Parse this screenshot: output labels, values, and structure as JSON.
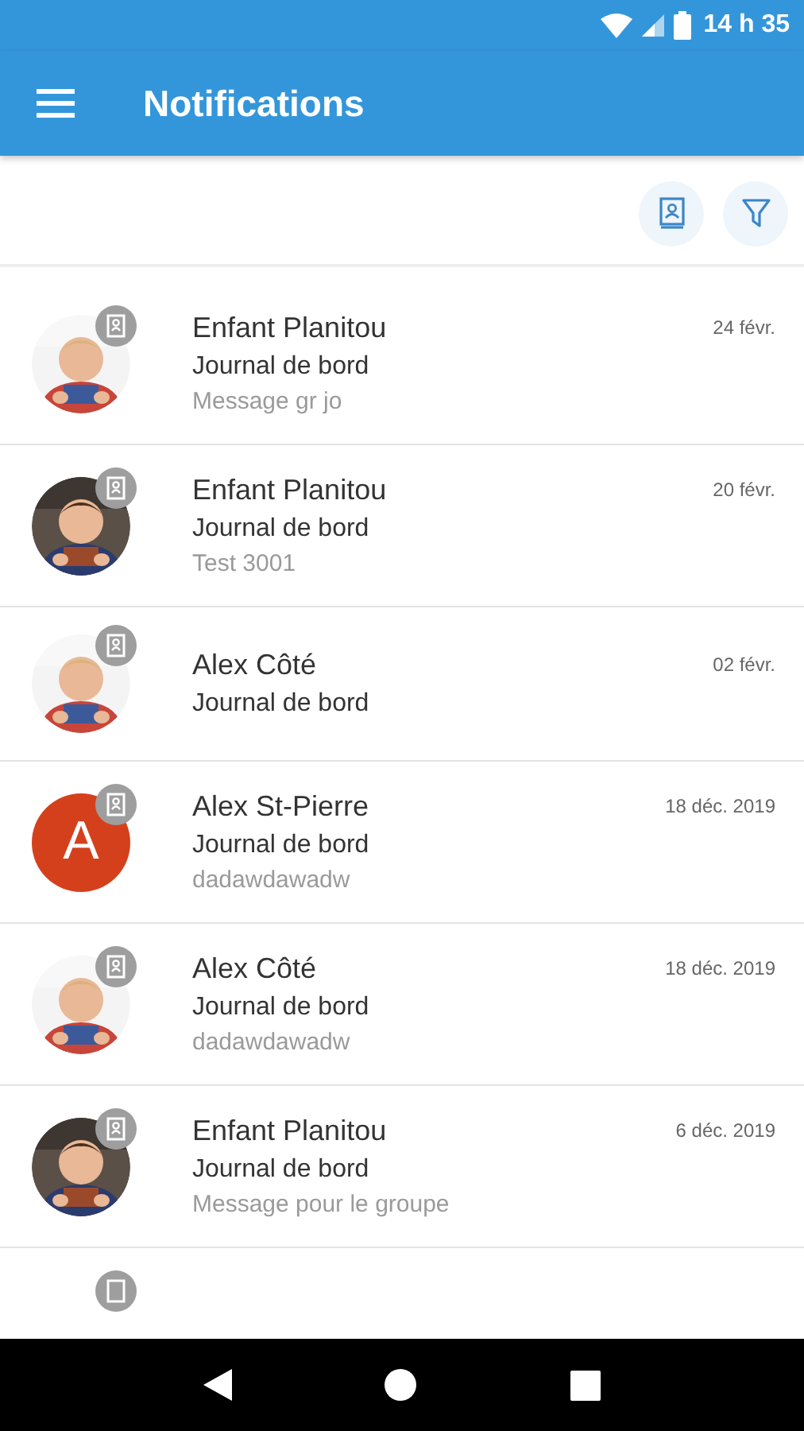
{
  "status_bar": {
    "time": "14 h 35"
  },
  "app_bar": {
    "title": "Notifications"
  },
  "notifications": [
    {
      "name": "Enfant Planitou",
      "category": "Journal de bord",
      "message": "Message gr jo",
      "date": "24 févr."
    },
    {
      "name": "Enfant Planitou",
      "category": "Journal de bord",
      "message": "Test 3001",
      "date": "20 févr."
    },
    {
      "name": "Alex Côté",
      "category": "Journal de bord",
      "date": "02 févr."
    },
    {
      "avatar": {
        "kind": "letter",
        "letter": "A",
        "color": "#d5401c"
      },
      "name": "Alex St-Pierre",
      "category": "Journal de bord",
      "message": "dadawdawadw",
      "date": "18 déc. 2019"
    },
    {
      "name": "Alex Côté",
      "category": "Journal de bord",
      "message": "dadawdawadw",
      "date": "18 déc. 2019"
    },
    {
      "name": "Enfant Planitou",
      "category": "Journal de bord",
      "message": "Message pour le groupe",
      "date": "6 déc. 2019"
    }
  ]
}
